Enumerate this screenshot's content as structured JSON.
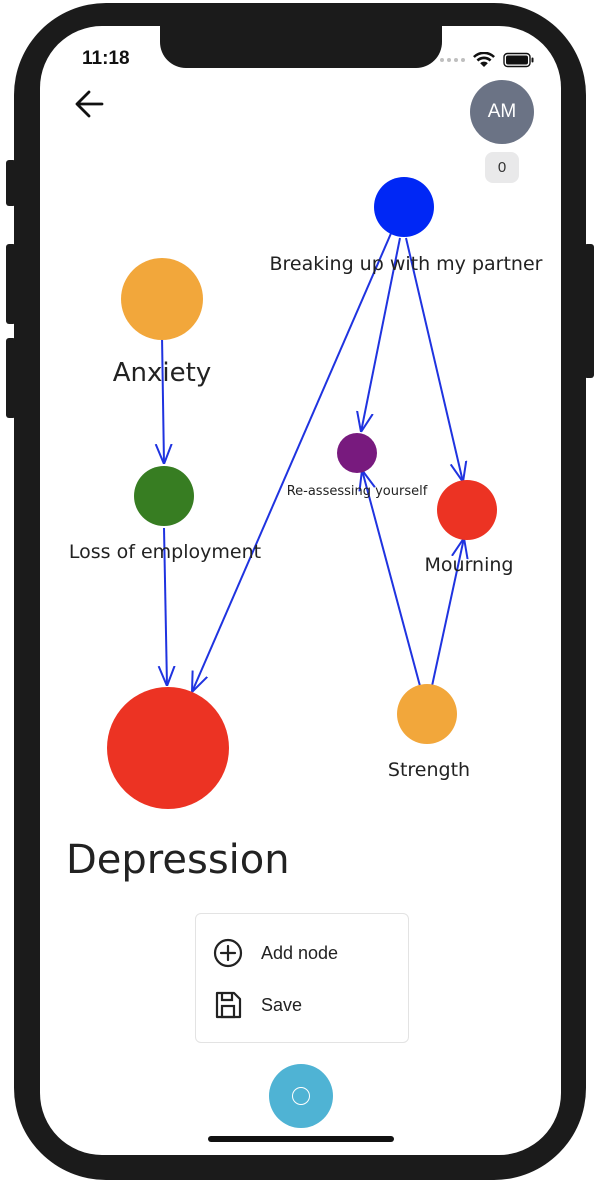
{
  "status_bar": {
    "time": "11:18"
  },
  "header": {
    "back_icon": "arrow-left-icon"
  },
  "user": {
    "initials": "AM",
    "count": "0",
    "avatar_color": "#6b7385"
  },
  "graph": {
    "nodes": [
      {
        "id": "anxiety",
        "label": "Anxiety",
        "color": "#f2a73b"
      },
      {
        "id": "loss",
        "label": "Loss of employment",
        "color": "#377d22"
      },
      {
        "id": "depression",
        "label": "Depression",
        "color": "#ec3323"
      },
      {
        "id": "breakup",
        "label": "Breaking up with my partner",
        "color": "#0027f5"
      },
      {
        "id": "reassess",
        "label": "Re-assessing yourself",
        "color": "#781a7e"
      },
      {
        "id": "mourning",
        "label": "Mourning",
        "color": "#ec3323"
      },
      {
        "id": "strength",
        "label": "Strength",
        "color": "#f2a73b"
      }
    ],
    "edges": [
      {
        "from": "anxiety",
        "to": "loss"
      },
      {
        "from": "loss",
        "to": "depression"
      },
      {
        "from": "breakup",
        "to": "depression"
      },
      {
        "from": "breakup",
        "to": "reassess"
      },
      {
        "from": "breakup",
        "to": "mourning"
      },
      {
        "from": "strength",
        "to": "reassess"
      },
      {
        "from": "strength",
        "to": "mourning"
      }
    ],
    "edge_color": "#1f33e0"
  },
  "menu": {
    "add_node_label": "Add node",
    "add_node_icon": "plus-circle-icon",
    "save_label": "Save",
    "save_icon": "floppy-disk-icon"
  },
  "fab": {
    "icon": "circle-icon",
    "color": "#4fb3d4"
  }
}
